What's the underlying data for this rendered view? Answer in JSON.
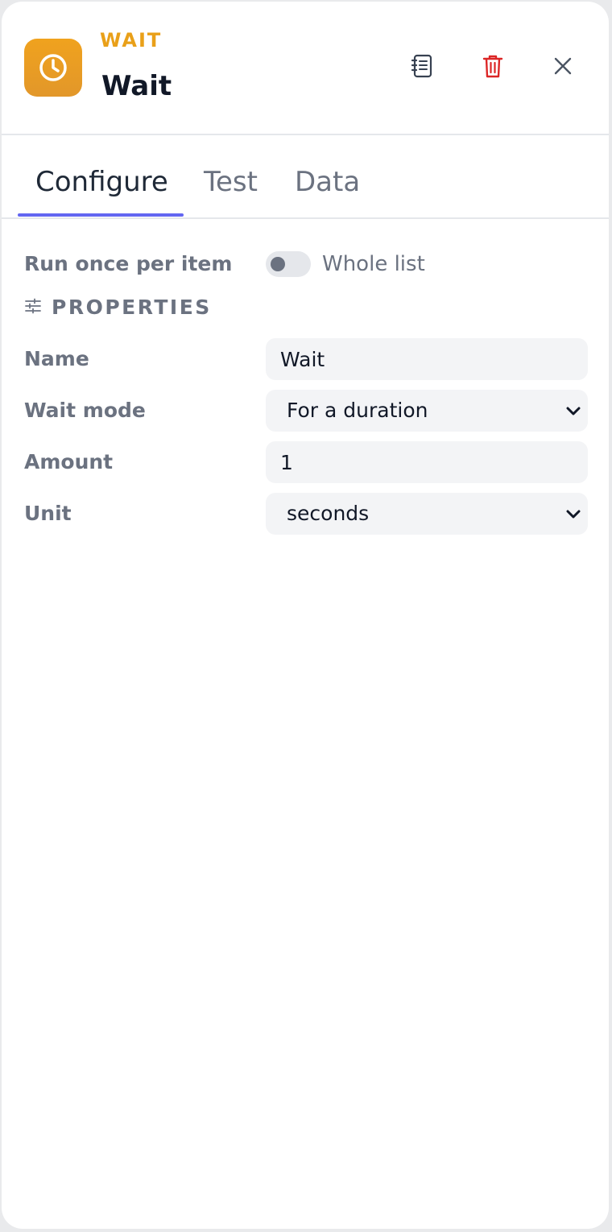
{
  "header": {
    "node_type": "WAIT",
    "title": "Wait",
    "icon": "clock-icon",
    "actions": [
      {
        "name": "notes-icon"
      },
      {
        "name": "trash-icon"
      },
      {
        "name": "close-icon"
      }
    ]
  },
  "tabs": [
    {
      "label": "Configure",
      "active": true
    },
    {
      "label": "Test",
      "active": false
    },
    {
      "label": "Data",
      "active": false
    }
  ],
  "run_mode": {
    "label": "Run once per item",
    "toggle_label": "Whole list",
    "toggle_on": false
  },
  "properties": {
    "section_title": "PROPERTIES",
    "name_label": "Name",
    "name_value": "Wait",
    "wait_mode_label": "Wait mode",
    "wait_mode_value": "For a duration",
    "amount_label": "Amount",
    "amount_value": "1",
    "unit_label": "Unit",
    "unit_value": "seconds"
  },
  "colors": {
    "accent": "#6366f1",
    "brand": "#e9a019",
    "danger": "#dc2626"
  }
}
